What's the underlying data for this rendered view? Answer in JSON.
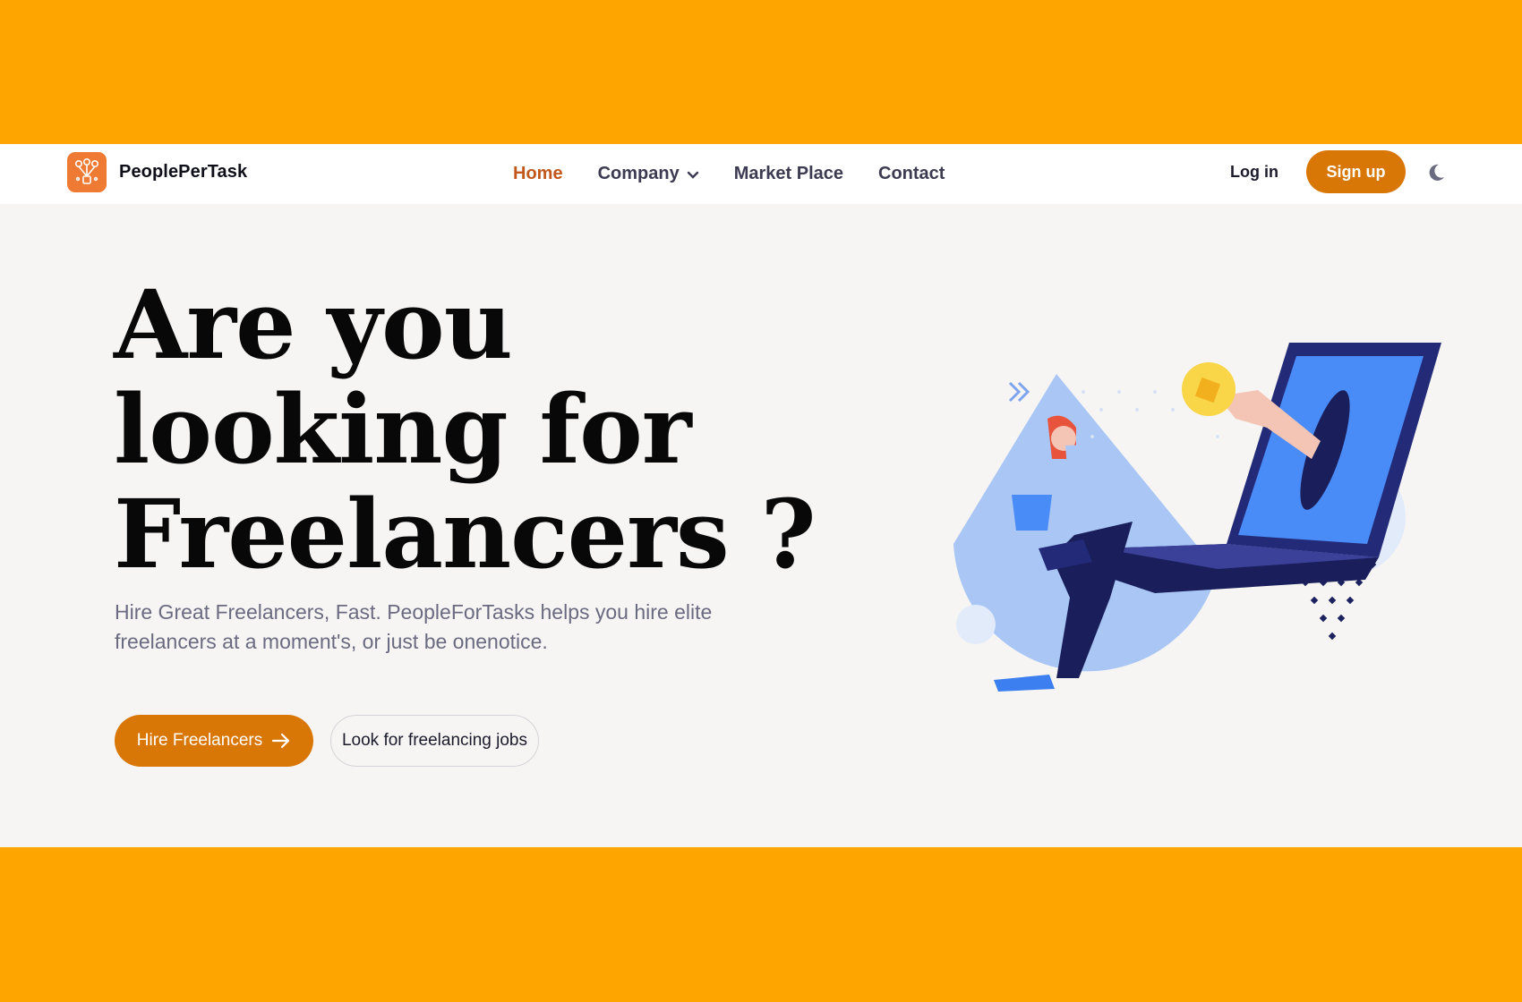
{
  "brand": {
    "name": "PeoplePerTask"
  },
  "nav": {
    "links": [
      {
        "label": "Home",
        "active": true
      },
      {
        "label": "Company",
        "has_dropdown": true
      },
      {
        "label": "Market Place"
      },
      {
        "label": "Contact"
      }
    ],
    "login_label": "Log in",
    "signup_label": "Sign up"
  },
  "hero": {
    "headline_line1": "Are you",
    "headline_line2": "looking for",
    "headline_line3": "Freelancers ?",
    "subtext_line1": "Hire Great Freelancers, Fast. PeopleForTasks helps you hire elite",
    "subtext_line2": "freelancers at a moment's, or just be onenotice.",
    "primary_cta": "Hire Freelancers",
    "secondary_cta": "Look for freelancing jobs"
  },
  "colors": {
    "page_band": "#FFA500",
    "accent": "#D97706",
    "active_nav": "#C2571C",
    "hero_bg": "#F6F5F4",
    "logo_bg": "#EE7A33"
  },
  "icons": {
    "logo": "network-people-icon",
    "dropdown": "chevron-down-icon",
    "theme_toggle": "moon-icon",
    "cta_arrow": "arrow-right-icon"
  }
}
